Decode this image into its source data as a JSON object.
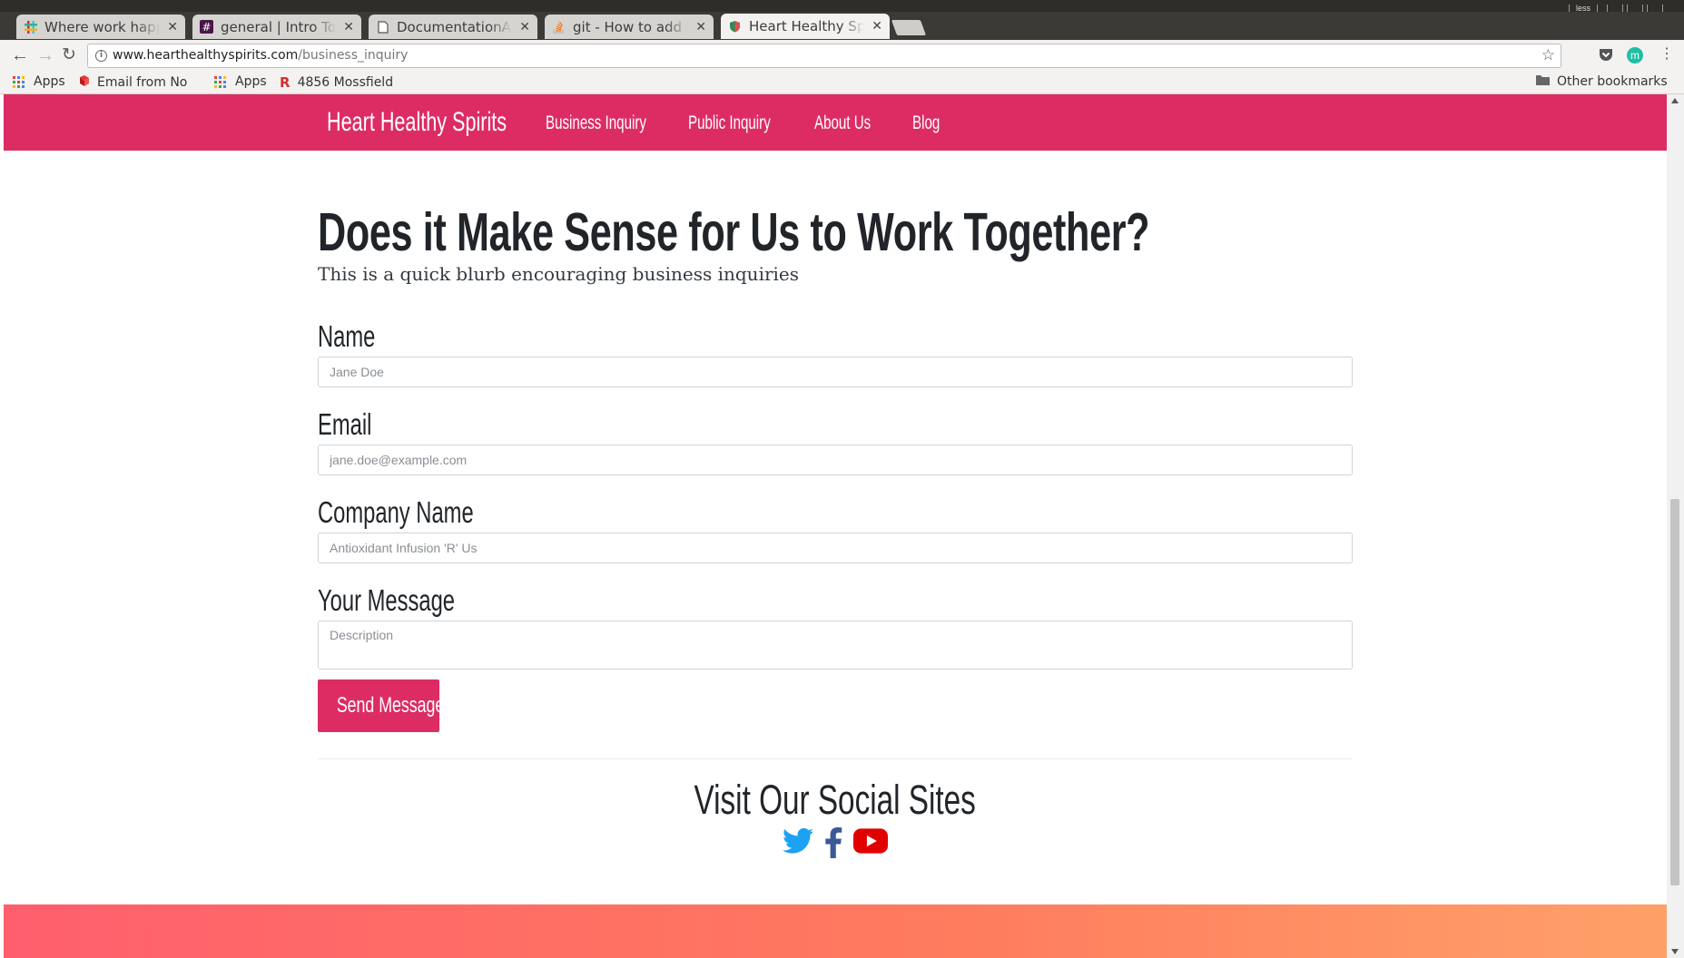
{
  "browser": {
    "tabs": [
      {
        "title": "Where work happens",
        "icon": "slack-icon"
      },
      {
        "title": "general | Intro To Software",
        "icon": "slack-channel-icon"
      },
      {
        "title": "DocumentationAssignment",
        "icon": "document-icon"
      },
      {
        "title": "git - How to add scripts",
        "icon": "stackoverflow-icon"
      },
      {
        "title": "Heart Healthy Spirits",
        "icon": "site-favicon"
      }
    ],
    "window_label": "less",
    "url_host": "www.hearthealthyspirits.com",
    "url_path": "/business_inquiry",
    "bookmarks": [
      {
        "label": "Apps",
        "icon": "apps-grid-icon"
      },
      {
        "label": "Email from Nov",
        "icon": "email-bookmark-icon"
      },
      {
        "label": "Apps",
        "icon": "apps-grid-icon"
      },
      {
        "label": "4856 Mossfield",
        "icon": "r-logo-icon"
      }
    ],
    "other_bookmarks": "Other bookmarks",
    "extension_letter": "m"
  },
  "site": {
    "brand": "Heart Healthy Spirits",
    "nav": [
      "Business Inquiry",
      "Public Inquiry",
      "About Us",
      "Blog"
    ],
    "accent_color": "#dd2c63"
  },
  "page": {
    "heading": "Does it Make Sense for Us to Work Together?",
    "blurb": "This is a quick blurb encouraging business inquiries"
  },
  "form": {
    "name_label": "Name",
    "name_placeholder": "Jane Doe",
    "email_label": "Email",
    "email_placeholder": "jane.doe@example.com",
    "company_label": "Company Name",
    "company_placeholder": "Antioxidant Infusion 'R' Us",
    "message_label": "Your Message",
    "message_placeholder": "Description",
    "submit_label": "Send Message"
  },
  "social": {
    "title": "Visit Our Social Sites",
    "icons": [
      "twitter-icon",
      "facebook-icon",
      "youtube-icon"
    ]
  }
}
